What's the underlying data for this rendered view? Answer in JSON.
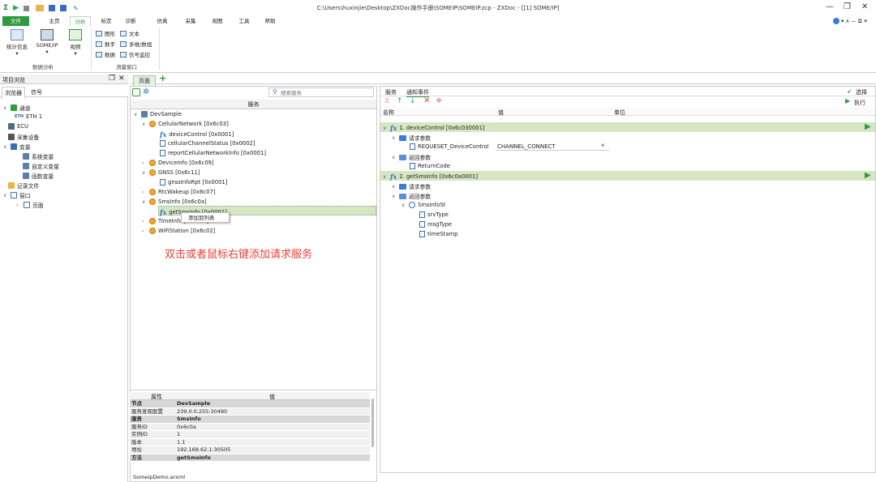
{
  "window": {
    "title": "C:\\Users\\huxinjie\\Desktop\\ZXDoc操作手册\\SOMEIP\\SOMEIP.zcp - ZXDoc - [[1] SOME/IP]",
    "controls": [
      "—",
      "❐",
      "✕"
    ],
    "right_controls": "▾  ∧ — ⧉ ✕"
  },
  "ribbon_tabs": [
    "文件",
    "主页",
    "分析",
    "标定",
    "诊断",
    "仿真",
    "采集",
    "视图",
    "工具",
    "帮助"
  ],
  "ribbon": {
    "buttons": [
      {
        "label": "统计信息",
        "sub": "▾"
      },
      {
        "label": "SOME/IP",
        "sub": "▾"
      },
      {
        "label": "视频",
        "sub": "▾"
      }
    ],
    "group1_label": "数据分析",
    "small_items": [
      "图形",
      "文本",
      "数字",
      "多维/数组",
      "数据",
      "信号监控"
    ],
    "group2_label": "测量窗口"
  },
  "left_panel": {
    "title": "项目浏览",
    "tabs": [
      "浏览器",
      "信号"
    ],
    "tree": [
      {
        "label": "通道",
        "level": 0
      },
      {
        "label": "ETH 1",
        "prefix": "ETH",
        "level": 1
      },
      {
        "label": "ECU",
        "level": 0
      },
      {
        "label": "采集设备",
        "level": 0
      },
      {
        "label": "变量",
        "level": 0
      },
      {
        "label": "系统变量",
        "level": 1
      },
      {
        "label": "自定义变量",
        "level": 1
      },
      {
        "label": "函数变量",
        "level": 1
      },
      {
        "label": "记录文件",
        "level": 0
      },
      {
        "label": "窗口",
        "level": 0
      },
      {
        "label": "页面",
        "level": 1
      }
    ]
  },
  "page_tab": {
    "label": "页面",
    "add": "+"
  },
  "services_panel": {
    "search_placeholder": "搜索服务",
    "header": "服务",
    "tree": [
      {
        "label": "DevSample",
        "level": 0
      },
      {
        "label": "CellularNetwork [0x6c03]",
        "level": 1
      },
      {
        "label": "deviceControl [0x0001]",
        "level": 2,
        "kind": "fx"
      },
      {
        "label": "cellularChannelStatus [0x0002]",
        "level": 2,
        "kind": "doc"
      },
      {
        "label": "reportCellularNetworkInfo [0x0001]",
        "level": 2,
        "kind": "doc"
      },
      {
        "label": "DeviceInfo [0x6c09]",
        "level": 1
      },
      {
        "label": "GNSS [0x6c11]",
        "level": 1
      },
      {
        "label": "gnssInfoRpt [0x0001]",
        "level": 2,
        "kind": "doc"
      },
      {
        "label": "RtcWakeup [0x6c07]",
        "level": 1
      },
      {
        "label": "SmsInfo [0x6c0a]",
        "level": 1
      },
      {
        "label": "getSmsInfo [0x0001]",
        "level": 2,
        "kind": "fx"
      },
      {
        "label": "TimeInfo [0x6c08]",
        "level": 1
      },
      {
        "label": "WiFiStation [0x6c02]",
        "level": 1
      }
    ],
    "context_menu": "添加到列表",
    "annotation": "双击或者鼠标右键添加请求服务"
  },
  "properties": {
    "col_key": "属性",
    "col_val": "值",
    "rows": [
      {
        "k": "节点",
        "v": "DevSample",
        "sec": true
      },
      {
        "k": "服务发现配置",
        "v": "239.0.0.255:30490",
        "sec": false
      },
      {
        "k": "服务",
        "v": "SmsInfo",
        "sec": true
      },
      {
        "k": "服务ID",
        "v": "0x6c0a",
        "sec": false
      },
      {
        "k": "实例ID",
        "v": "1",
        "sec": false
      },
      {
        "k": "版本",
        "v": "1.1",
        "sec": false
      },
      {
        "k": "地址",
        "v": "192.168.62.1:30505",
        "sec": false
      },
      {
        "k": "方法",
        "v": "getSmsInfo",
        "sec": true
      }
    ]
  },
  "status_file": "SomeipDemo.arxml",
  "right_panel": {
    "tabs": [
      "服务",
      "通知事件"
    ],
    "select_label": "选择",
    "exec_label": "执行",
    "cols": [
      "名称",
      "值",
      "单位"
    ],
    "tree": [
      {
        "label": "1. deviceControl [0x6c030001]",
        "level": 0,
        "kind": "fx",
        "hl": true
      },
      {
        "label": "请求参数",
        "level": 1,
        "kind": "env"
      },
      {
        "label": "REQUESET_DeviceControl",
        "level": 2,
        "kind": "doc",
        "value": "CHANNEL_CONNECT"
      },
      {
        "label": "返回参数",
        "level": 1,
        "kind": "env"
      },
      {
        "label": "ReturnCode",
        "level": 2,
        "kind": "doc"
      },
      {
        "label": "2. getSmsInfo [0x6c0a0001]",
        "level": 0,
        "kind": "fx",
        "hl": true
      },
      {
        "label": "请求参数",
        "level": 1,
        "kind": "env"
      },
      {
        "label": "返回参数",
        "level": 1,
        "kind": "env"
      },
      {
        "label": "SmsInfoSt",
        "level": 2,
        "kind": "struct"
      },
      {
        "label": "srvType",
        "level": 3,
        "kind": "doc"
      },
      {
        "label": "msgType",
        "level": 3,
        "kind": "doc"
      },
      {
        "label": "timeStamp",
        "level": 3,
        "kind": "doc"
      }
    ]
  }
}
